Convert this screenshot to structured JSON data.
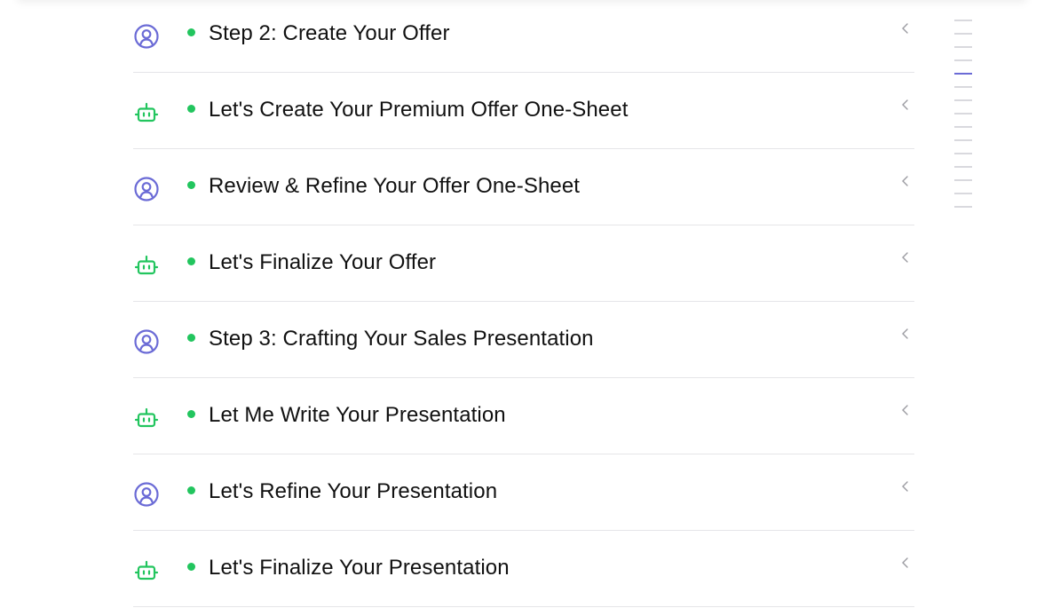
{
  "colors": {
    "user_icon": "#6b6bd6",
    "bot_icon": "#22c55e",
    "status_dot": "#22c55e",
    "divider": "#e5e5e8",
    "minimap_tick": "#d9d9de",
    "minimap_active": "#6b6bd6"
  },
  "steps": [
    {
      "role": "user",
      "icon": "user-circle-icon",
      "status": "complete",
      "title": "Step 2: Create Your Offer"
    },
    {
      "role": "assistant",
      "icon": "robot-icon",
      "status": "complete",
      "title": "Let's Create Your Premium Offer One-Sheet"
    },
    {
      "role": "user",
      "icon": "user-circle-icon",
      "status": "complete",
      "title": "Review & Refine Your Offer One-Sheet"
    },
    {
      "role": "assistant",
      "icon": "robot-icon",
      "status": "complete",
      "title": "Let's Finalize Your Offer"
    },
    {
      "role": "user",
      "icon": "user-circle-icon",
      "status": "complete",
      "title": "Step 3: Crafting Your Sales Presentation"
    },
    {
      "role": "assistant",
      "icon": "robot-icon",
      "status": "complete",
      "title": "Let Me Write Your Presentation"
    },
    {
      "role": "user",
      "icon": "user-circle-icon",
      "status": "complete",
      "title": "Let's Refine Your Presentation"
    },
    {
      "role": "assistant",
      "icon": "robot-icon",
      "status": "complete",
      "title": "Let's Finalize Your Presentation"
    }
  ],
  "minimap": {
    "tick_count": 15,
    "active_index": 4
  }
}
